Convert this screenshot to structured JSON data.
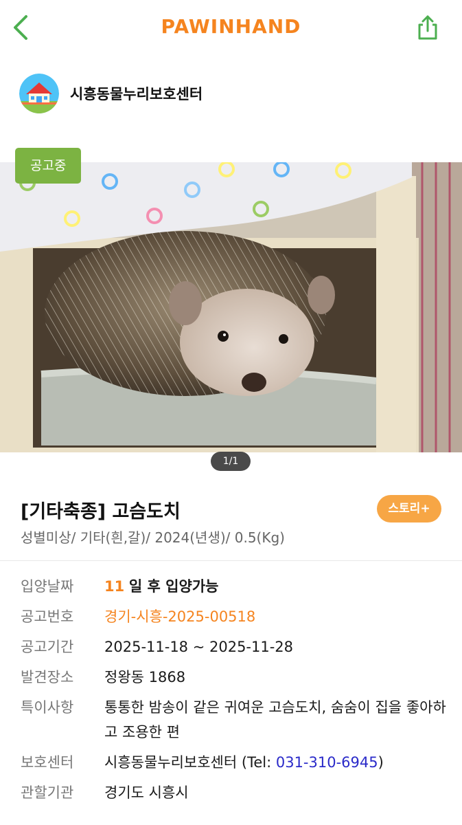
{
  "header": {
    "brand": "PAWINHAND",
    "back_icon": "chevron-left-icon",
    "share_icon": "share-icon",
    "accent_color": "#f5841f",
    "icon_color": "#4caf50"
  },
  "shelter": {
    "name": "시흥동물누리보호센터",
    "avatar_icon": "house-icon"
  },
  "photo": {
    "status_badge": "공고중",
    "pager": "1/1"
  },
  "animal": {
    "title": "[기타축종] 고슴도치",
    "story_button": "스토리+",
    "summary": "성별미상/ 기타(흰,갈)/ 2024(년생)/ 0.5(Kg)"
  },
  "info": {
    "adoption_date_label": "입양날짜",
    "adoption_days": "11",
    "adoption_suffix": "일 후 입양가능",
    "notice_no_label": "공고번호",
    "notice_no": "경기-시흥-2025-00518",
    "notice_period_label": "공고기간",
    "notice_period": "2025-11-18 ~ 2025-11-28",
    "found_place_label": "발견장소",
    "found_place": "정왕동 1868",
    "notes_label": "특이사항",
    "notes": "통통한 밤송이 같은 귀여운 고슴도치, 숨숨이 집을 좋아하고 조용한 편",
    "shelter_label": "보호센터",
    "shelter_value": "시흥동물누리보호센터 (Tel: ",
    "shelter_tel": "031-310-6945",
    "shelter_close": ")",
    "authority_label": "관할기관",
    "authority": "경기도 시흥시"
  }
}
